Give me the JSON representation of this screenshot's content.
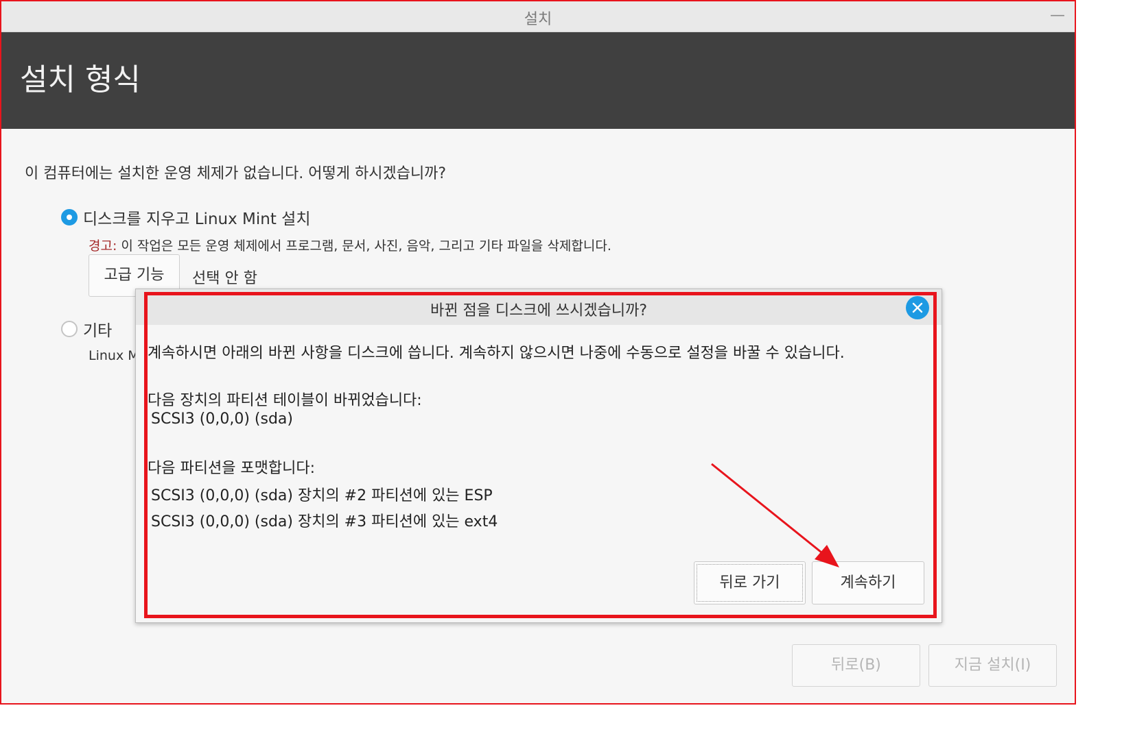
{
  "window": {
    "title": "설치",
    "minimize_glyph": "—"
  },
  "header": {
    "heading": "설치 형식"
  },
  "main": {
    "question": "이 컴퓨터에는 설치한 운영 체제가 없습니다. 어떻게 하시겠습니까?",
    "option_erase": {
      "label": "디스크를 지우고 Linux Mint 설치",
      "selected": true
    },
    "warning": {
      "label": "경고:",
      "text": " 이 작업은 모든 운영 체제에서 프로그램, 문서, 사진, 음악, 그리고 기타 파일을 삭제합니다."
    },
    "advanced_button": "고급 기능",
    "advanced_status": "선택 안 함",
    "option_other": {
      "label": "기타",
      "selected": false
    },
    "other_desc_visible": "Linux M",
    "buttons": {
      "back": "뒤로(B)",
      "install_now": "지금 설치(I)"
    }
  },
  "dialog": {
    "title": "바뀐 점을 디스크에 쓰시겠습니까?",
    "intro": "계속하시면 아래의 바뀐 사항을 디스크에 씁니다. 계속하지 않으시면 나중에 수동으로 설정을 바꿀 수 있습니다.",
    "partition_table_heading": "다음 장치의 파티션 테이블이 바뀌었습니다:",
    "partition_table_devices": [
      "SCSI3 (0,0,0) (sda)"
    ],
    "format_heading": "다음 파티션을 포맷합니다:",
    "format_partitions": [
      "SCSI3 (0,0,0) (sda) 장치의 #2 파티션에 있는 ESP",
      "SCSI3 (0,0,0) (sda) 장치의 #3 파티션에 있는 ext4"
    ],
    "back_button": "뒤로 가기",
    "continue_button": "계속하기"
  },
  "colors": {
    "accent": "#1d9ae3",
    "header_bg": "#404040",
    "annotation": "#e8141c",
    "warning": "#a52a2a"
  }
}
